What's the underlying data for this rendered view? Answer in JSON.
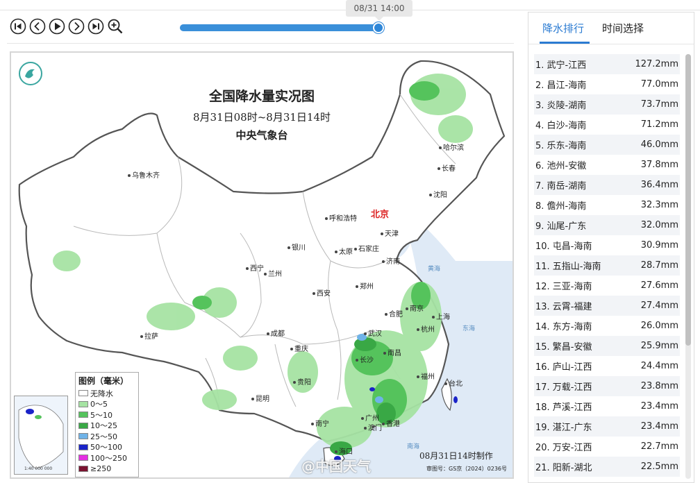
{
  "player": {
    "current_time_label": "08/31 14:00",
    "progress_fraction": 0.98
  },
  "map": {
    "title": "全国降水量实况图",
    "subtitle": "8月31日08时~8月31日14时",
    "organization": "中央气象台",
    "made_time": "08月31日14时制作",
    "approval_code": "审图号：GS京（2024）0236号",
    "scale_text": "1:40 000 000",
    "watermark": "@中国天气",
    "capital": "北京",
    "cities": [
      "乌鲁木齐",
      "哈尔滨",
      "长春",
      "沈阳",
      "呼和浩特",
      "天津",
      "银川",
      "石家庄",
      "太原",
      "济南",
      "西宁",
      "兰州",
      "郑州",
      "西安",
      "合肥",
      "南京",
      "上海",
      "杭州",
      "拉萨",
      "成都",
      "武汉",
      "重庆",
      "南昌",
      "长沙",
      "福州",
      "台北",
      "贵阳",
      "昆明",
      "广州",
      "澳门",
      "香港",
      "南宁",
      "海口"
    ],
    "seas": [
      "黄海",
      "东海",
      "南海"
    ],
    "legend": {
      "title": "图例（毫米）",
      "items": [
        {
          "label": "无降水",
          "color": "#ffffff"
        },
        {
          "label": "0～5",
          "color": "#a6e3a3"
        },
        {
          "label": "5～10",
          "color": "#55c35c"
        },
        {
          "label": "10～25",
          "color": "#39a845"
        },
        {
          "label": "25～50",
          "color": "#6fb3e8"
        },
        {
          "label": "50～100",
          "color": "#1a23c8"
        },
        {
          "label": "100～250",
          "color": "#e52fe3"
        },
        {
          "label": "≥250",
          "color": "#7a1330"
        }
      ]
    }
  },
  "ranking": {
    "tabs": [
      {
        "label": "降水排行",
        "active": true
      },
      {
        "label": "时间选择",
        "active": false
      }
    ],
    "rows": [
      {
        "name": "1. 武宁-江西",
        "value": "127.2mm"
      },
      {
        "name": "2. 昌江-海南",
        "value": "77.0mm"
      },
      {
        "name": "3. 炎陵-湖南",
        "value": "73.7mm"
      },
      {
        "name": "4. 白沙-海南",
        "value": "71.2mm"
      },
      {
        "name": "5. 乐东-海南",
        "value": "46.0mm"
      },
      {
        "name": "6. 池州-安徽",
        "value": "37.8mm"
      },
      {
        "name": "7. 南岳-湖南",
        "value": "36.4mm"
      },
      {
        "name": "8. 儋州-海南",
        "value": "32.3mm"
      },
      {
        "name": "9. 汕尾-广东",
        "value": "32.0mm"
      },
      {
        "name": "10. 屯昌-海南",
        "value": "30.9mm"
      },
      {
        "name": "11. 五指山-海南",
        "value": "28.7mm"
      },
      {
        "name": "12. 三亚-海南",
        "value": "27.6mm"
      },
      {
        "name": "13. 云霄-福建",
        "value": "27.4mm"
      },
      {
        "name": "14. 东方-海南",
        "value": "26.0mm"
      },
      {
        "name": "15. 繁昌-安徽",
        "value": "25.9mm"
      },
      {
        "name": "16. 庐山-江西",
        "value": "24.4mm"
      },
      {
        "name": "17. 万载-江西",
        "value": "23.8mm"
      },
      {
        "name": "18. 芦溪-江西",
        "value": "23.4mm"
      },
      {
        "name": "19. 湛江-广东",
        "value": "23.4mm"
      },
      {
        "name": "20. 万安-江西",
        "value": "22.7mm"
      },
      {
        "name": "21. 阳新-湖北",
        "value": "22.5mm"
      }
    ]
  }
}
